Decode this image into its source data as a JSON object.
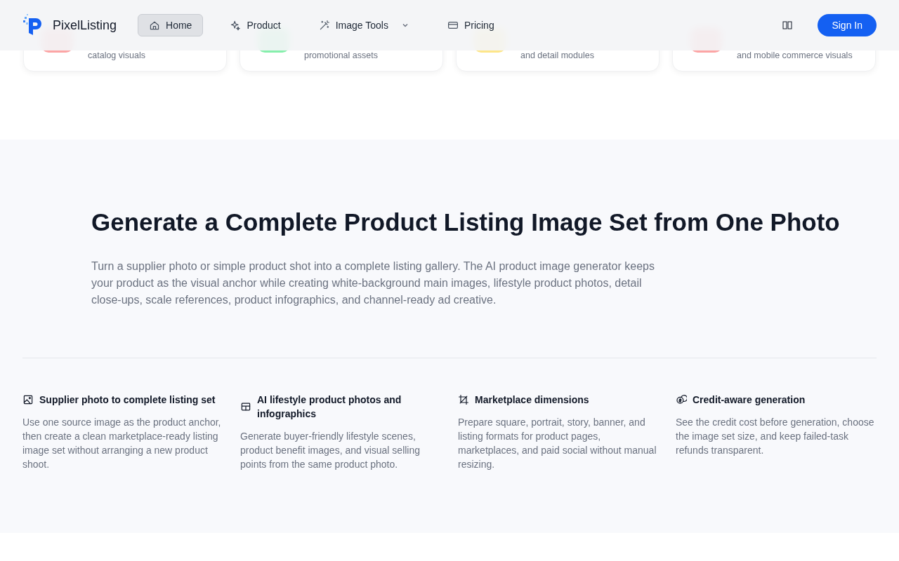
{
  "header": {
    "brand": "PixelListing",
    "nav": [
      {
        "label": "Home",
        "kind": "home",
        "selected": true,
        "dropdown": false
      },
      {
        "label": "Product",
        "kind": "product",
        "selected": false,
        "dropdown": false
      },
      {
        "label": "Image Tools",
        "kind": "tools",
        "selected": false,
        "dropdown": true
      },
      {
        "label": "Pricing",
        "kind": "pricing",
        "selected": false,
        "dropdown": false
      }
    ],
    "sign_in": "Sign In"
  },
  "cards": [
    {
      "text": "catalog visuals"
    },
    {
      "text": "promotional assets"
    },
    {
      "text": "and detail modules"
    },
    {
      "text": "and mobile commerce visuals"
    }
  ],
  "hero": {
    "title": "Generate a Complete Product Listing Image Set from One Photo",
    "body": "Turn a supplier photo or simple product shot into a complete listing gallery. The AI product image generator keeps your product as the visual anchor while creating white-background main images, lifestyle product photos, detail close-ups, scale references, product infographics, and channel-ready ad creative."
  },
  "features": [
    {
      "kind": "source",
      "title": "Supplier photo to complete listing set",
      "body": "Use one source image as the product anchor, then create a clean marketplace-ready listing image set without arranging a new product shoot."
    },
    {
      "kind": "lifestyle",
      "title": "AI lifestyle product photos and infographics",
      "body": "Generate buyer-friendly lifestyle scenes, product benefit images, and visual selling points from the same product photo."
    },
    {
      "kind": "dimensions",
      "title": "Marketplace dimensions",
      "body": "Prepare square, portrait, story, banner, and listing formats for product pages, marketplaces, and paid social without manual resizing."
    },
    {
      "kind": "credits",
      "title": "Credit-aware generation",
      "body": "See the credit cost before generation, choose the image set size, and keep failed-task refunds transparent."
    }
  ]
}
